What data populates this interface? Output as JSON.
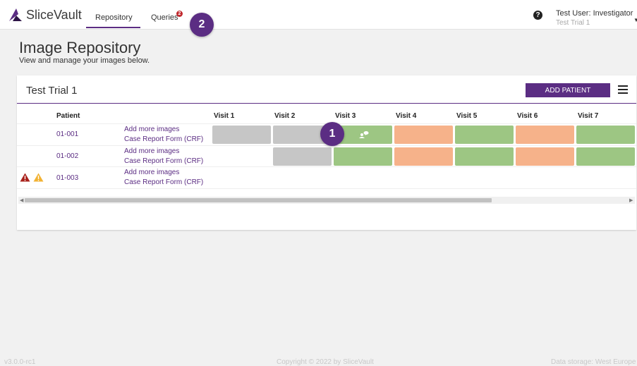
{
  "header": {
    "brand": "SliceVault",
    "tabs": [
      {
        "label": "Repository"
      },
      {
        "label": "Queries",
        "badge": "2"
      }
    ],
    "help_icon": "?",
    "user_name": "Test User: Investigator",
    "user_trial": "Test Trial 1"
  },
  "steps": {
    "one": "1",
    "two": "2"
  },
  "page": {
    "title": "Image Repository",
    "subtitle": "View and manage your images below."
  },
  "card": {
    "title": "Test Trial 1",
    "add_button": "ADD PATIENT",
    "columns": [
      "Patient",
      "Visit 1",
      "Visit 2",
      "Visit 3",
      "Visit 4",
      "Visit 5",
      "Visit 6",
      "Visit 7"
    ],
    "rows": [
      {
        "patient": "01-001",
        "link1": "Add more images",
        "link2": "Case Report Form (CRF)",
        "visits": [
          "grey",
          "grey",
          "green",
          "orange",
          "green",
          "orange",
          "green"
        ],
        "comment_on_visit": 3,
        "warnings": []
      },
      {
        "patient": "01-002",
        "link1": "Add more images",
        "link2": "Case Report Form (CRF)",
        "visits": [
          "",
          "grey",
          "green",
          "orange",
          "green",
          "orange",
          "green"
        ],
        "warnings": []
      },
      {
        "patient": "01-003",
        "link1": "Add more images",
        "link2": "Case Report Form (CRF)",
        "visits": [
          "",
          "",
          "",
          "",
          "",
          "",
          ""
        ],
        "warnings": [
          "error",
          "warning"
        ]
      }
    ]
  },
  "colors": {
    "accent": "#5b2d83",
    "grey": "#c6c6c6",
    "green": "#9dc683",
    "orange": "#f6b28a",
    "error": "#a8201a",
    "warning": "#f2b233"
  },
  "footer": {
    "version": "v3.0.0-rc1",
    "copyright": "Copyright © 2022 by SliceVault",
    "storage": "Data storage: West Europe"
  }
}
